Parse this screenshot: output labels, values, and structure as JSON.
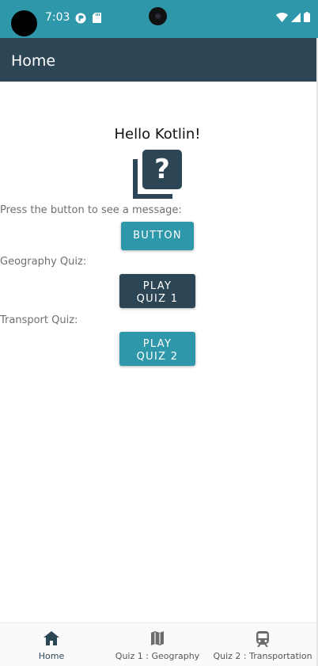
{
  "status_bar": {
    "time": "7:03"
  },
  "app_bar": {
    "title": "Home"
  },
  "main": {
    "greeting": "Hello Kotlin!",
    "prompt_label": "Press the button to see a message:",
    "button_label": "BUTTON",
    "geography_label": "Geography Quiz:",
    "play_quiz1_label": "PLAY\nQUIZ 1",
    "transport_label": "Transport Quiz:",
    "play_quiz2_label": "PLAY\nQUIZ 2"
  },
  "bottom_nav": {
    "items": [
      {
        "label": "Home",
        "icon": "home-icon",
        "selected": true
      },
      {
        "label": "Quiz 1 : Geography",
        "icon": "map-icon",
        "selected": false
      },
      {
        "label": "Quiz 2 : Transportation",
        "icon": "train-icon",
        "selected": false
      }
    ]
  },
  "colors": {
    "primary": "#2d4656",
    "accent": "#2e97a9",
    "label_text": "#6f6f6f"
  }
}
